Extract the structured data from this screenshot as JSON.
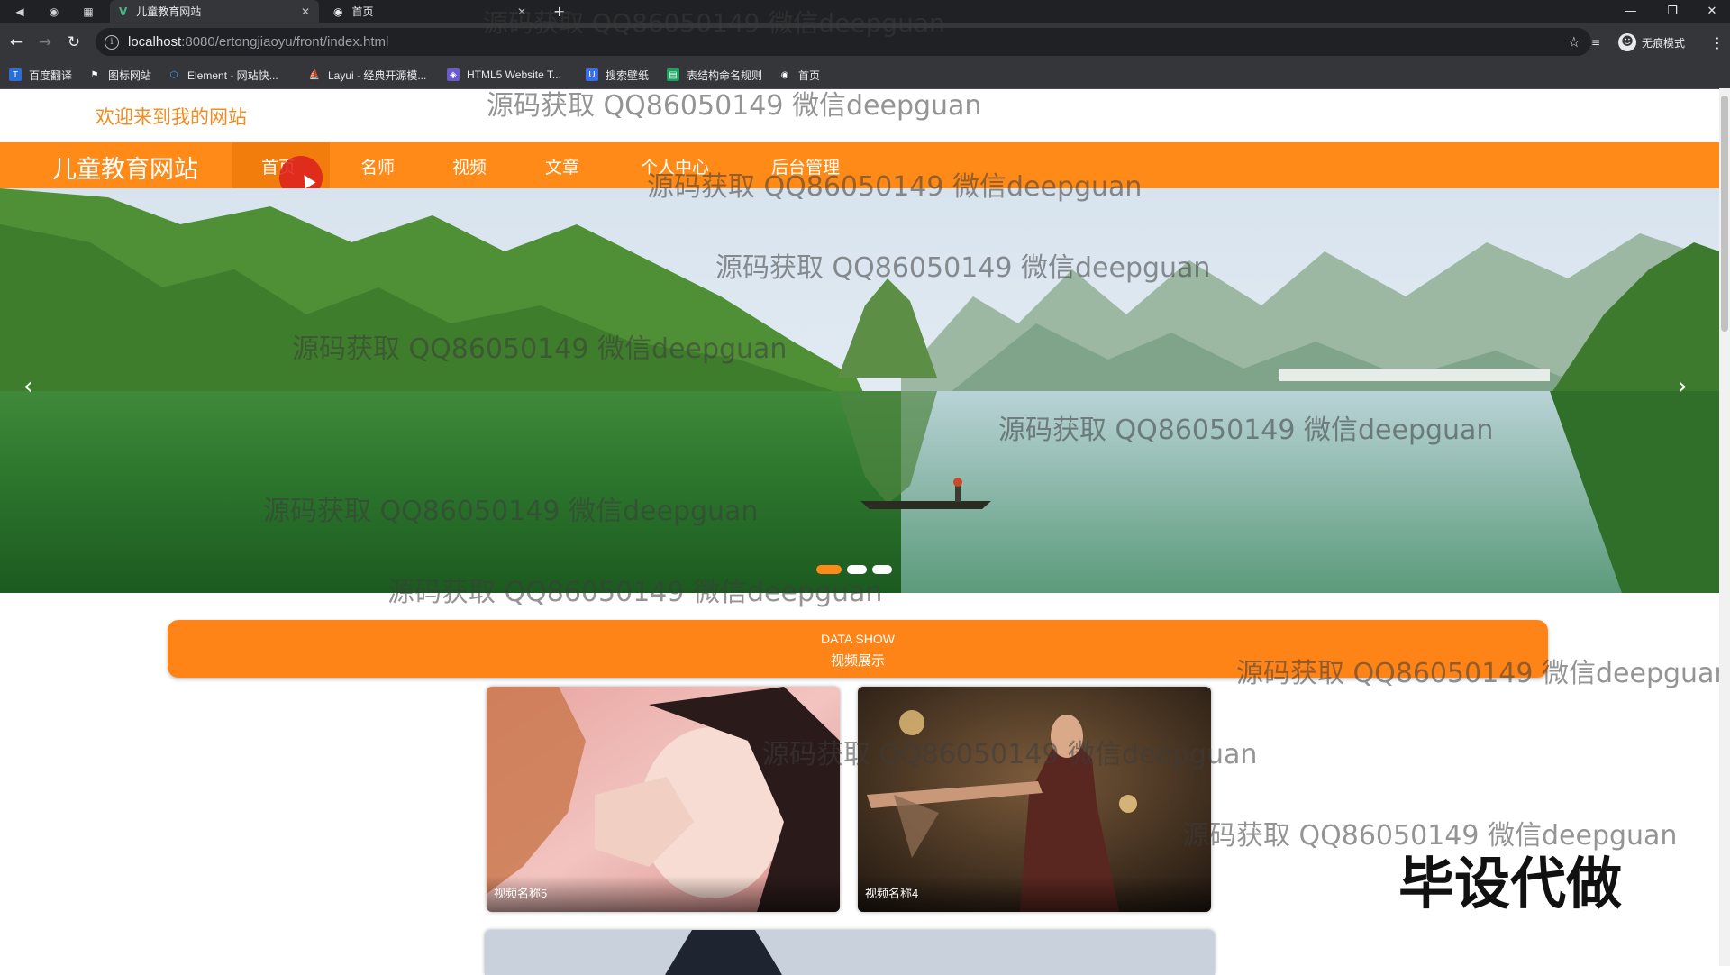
{
  "browser": {
    "tabs": [
      {
        "title": "儿童教育网站"
      },
      {
        "title": "首页"
      }
    ],
    "new_tab": "+",
    "url_host": "localhost",
    "url_rest": ":8080/ertongjiaoyu/front/index.html",
    "incognito_label": "无痕模式",
    "bookmarks": [
      "百度翻译",
      "图标网站",
      "Element - 网站快...",
      "Layui - 经典开源模...",
      "HTML5 Website T...",
      "搜索壁纸",
      "表结构命名规则",
      "首页"
    ]
  },
  "header": {
    "welcome": "欢迎来到我的网站"
  },
  "nav": {
    "logo": "儿童教育网站",
    "items": [
      "首页",
      "名师",
      "视频",
      "文章",
      "个人中心",
      "后台管理"
    ],
    "active_index": 0,
    "accent_color": "#ff8a17"
  },
  "carousel": {
    "prev": "‹",
    "next": "›",
    "slide_count": 3,
    "active_slide": 1
  },
  "section": {
    "title_en": "DATA SHOW",
    "title_cn": "视频展示"
  },
  "videos": [
    {
      "name": "视频名称5"
    },
    {
      "name": "视频名称4"
    }
  ],
  "watermark": "源码获取 QQ86050149 微信deepguan",
  "stamp": "毕设代做"
}
